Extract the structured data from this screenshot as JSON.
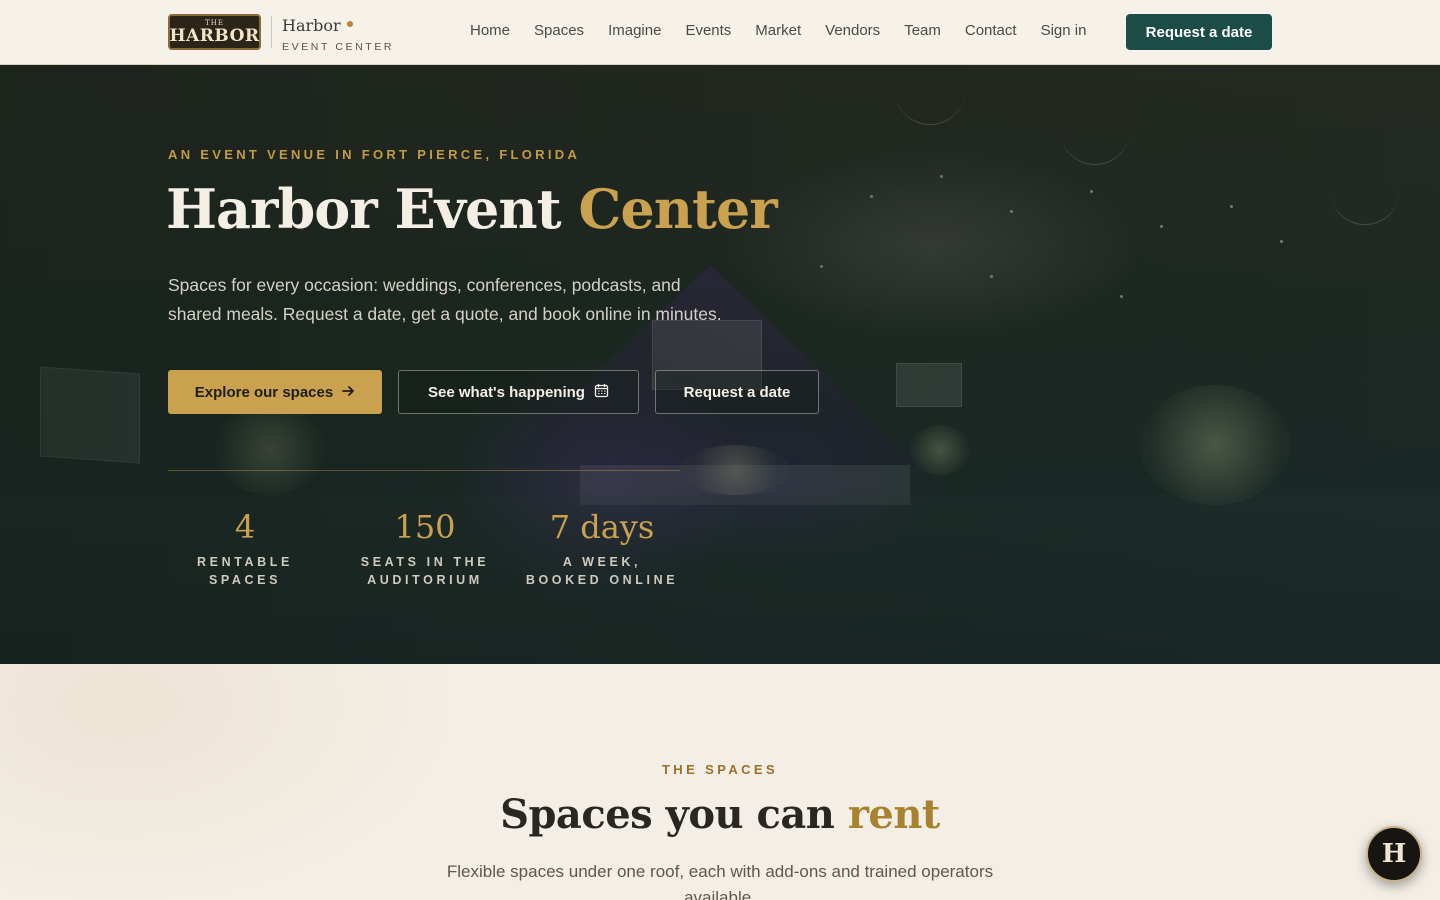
{
  "nav": {
    "logo_top": "THE",
    "logo_main": "HARBOR",
    "brand_name": "Harbor",
    "brand_sub": "EVENT CENTER",
    "links": [
      "Home",
      "Spaces",
      "Imagine",
      "Events",
      "Market",
      "Vendors",
      "Team",
      "Contact",
      "Sign in"
    ],
    "cta": "Request a date"
  },
  "hero": {
    "eyebrow": "AN EVENT VENUE IN FORT PIERCE, FLORIDA",
    "title_main": "Harbor Event ",
    "title_accent": "Center",
    "description": "Spaces for every occasion: weddings, conferences, podcasts, and shared meals. Request a date, get a quote, and book online in minutes.",
    "buttons": {
      "explore": "Explore our spaces",
      "events": "See what's happening",
      "request": "Request a date"
    },
    "stats": [
      {
        "value": "4",
        "label_1": "RENTABLE",
        "label_2": "SPACES"
      },
      {
        "value": "150",
        "label_1": "SEATS IN THE",
        "label_2": "AUDITORIUM"
      },
      {
        "value": "7 days",
        "label_1": "A WEEK,",
        "label_2": "BOOKED ONLINE"
      }
    ]
  },
  "spaces": {
    "eyebrow": "THE SPACES",
    "title_main": "Spaces you can ",
    "title_accent": "rent",
    "description": "Flexible spaces under one roof, each with add-ons and trained operators available."
  },
  "fab": {
    "letter": "H"
  },
  "colors": {
    "accent_gold": "#c9a14f",
    "brand_green": "#1c4c46",
    "cream": "#f4efe6"
  },
  "icons": {
    "explore_arrow": "arrow-right-icon",
    "events_calendar": "calendar-icon"
  }
}
